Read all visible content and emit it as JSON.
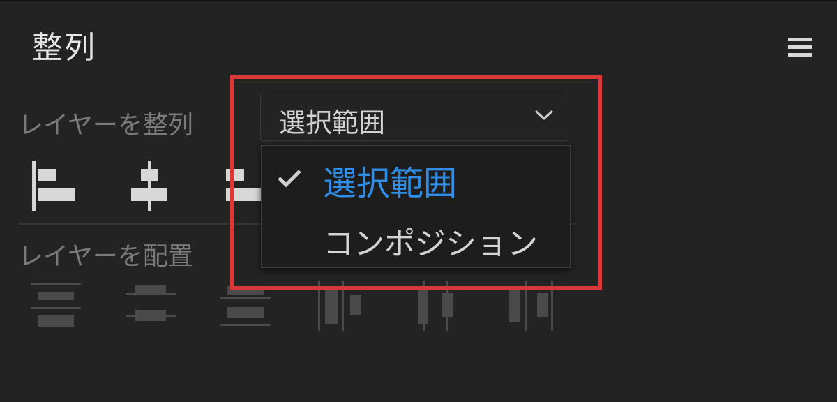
{
  "panel": {
    "title": "整列"
  },
  "align_section": {
    "label": "レイヤーを整列",
    "align_to": {
      "selected": "選択範囲"
    }
  },
  "distribute_section": {
    "label": "レイヤーを配置"
  },
  "dropdown": {
    "items": [
      {
        "label": "選択範囲",
        "checked": true
      },
      {
        "label": "コンポジション",
        "checked": false
      }
    ]
  },
  "icons": {
    "menu": "hamburger-menu-icon",
    "chevron": "chevron-down-icon",
    "check": "checkmark-icon",
    "align": [
      "align-left-icon",
      "align-horizontal-center-icon",
      "align-right-icon"
    ],
    "distribute": [
      "distribute-top-icon",
      "distribute-vertical-center-icon",
      "distribute-bottom-icon",
      "distribute-left-icon",
      "distribute-horizontal-center-icon",
      "distribute-right-icon"
    ]
  },
  "colors": {
    "background": "#232323",
    "selected_item": "#2f8fe8",
    "highlight": "#d9373a",
    "icon_light": "#d8d8d8",
    "icon_dim": "#4a4a4a"
  }
}
